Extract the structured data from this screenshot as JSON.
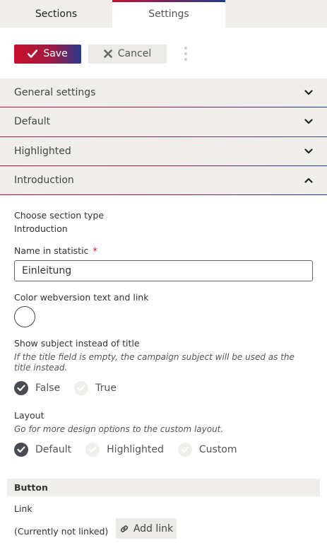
{
  "tabs": {
    "sections": "Sections",
    "settings": "Settings"
  },
  "toolbar": {
    "save_label": "Save",
    "cancel_label": "Cancel"
  },
  "accordion": {
    "general": "General settings",
    "default": "Default",
    "highlighted": "Highlighted",
    "introduction": "Introduction"
  },
  "form": {
    "section_type_label": "Choose section type",
    "section_type_value": "Introduction",
    "name_label": "Name in statistic",
    "required_mark": "*",
    "name_value": "Einleitung",
    "color_label": "Color webversion text and link",
    "subject_label": "Show subject instead of title",
    "subject_hint": "If the title field is empty, the campaign subject will be used as the title instead.",
    "subject_options": {
      "false": "False",
      "true": "True",
      "selected": "False"
    },
    "layout_label": "Layout",
    "layout_hint": "Go for more design options to the custom layout.",
    "layout_options": {
      "default": "Default",
      "highlighted": "Highlighted",
      "custom": "Custom",
      "selected": "Default"
    }
  },
  "button_section": {
    "title": "Button",
    "link_label": "Link",
    "link_status": "(Currently not linked)",
    "add_link_label": "Add link"
  },
  "colors": {
    "brand_red": "#c8102e",
    "brand_blue": "#1f3a8f",
    "panel_bg": "#efeeeb",
    "radio_on": "#4a4c55"
  },
  "icons": {
    "save": "check-icon",
    "cancel": "x-icon",
    "more": "kebab-icon",
    "collapse": "chevron-down-icon",
    "expand": "chevron-up-icon",
    "link": "link-icon"
  }
}
